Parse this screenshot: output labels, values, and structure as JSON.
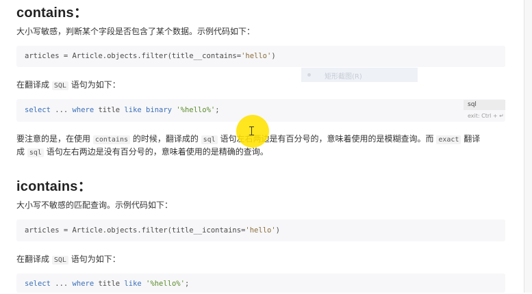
{
  "sections": {
    "contains": {
      "heading": "contains：",
      "intro": "大小写敏感，判断某个字段是否包含了某个数据。示例代码如下：",
      "code_python": {
        "lead": "articles = Article.objects.filter(title__contains=",
        "string": "'hello'",
        "tail": ")"
      },
      "sql_intro_prefix": "在翻译成 ",
      "sql_intro_code": "SQL",
      "sql_intro_suffix": " 语句为如下：",
      "code_sql": {
        "select": "select",
        "mid1": " ... ",
        "where": "where",
        "mid2": " title ",
        "like": "like",
        "mid3": " ",
        "binary": "binary",
        "mid4": " ",
        "string": "'%hello%'",
        "tail": ";"
      },
      "note_line1": {
        "p1": "要注意的是，在使用 ",
        "c1": "contains",
        "p2": " 的时候，翻译成的 ",
        "c2": "sql",
        "p3": " 语句左右两边是有百分号的，意味着使用的是模糊查询。而 ",
        "c3": "exact",
        "p4": " 翻译"
      },
      "note_line2": {
        "p1": "成 ",
        "c1": "sql",
        "p2": " 语句左右两边是没有百分号的，意味着使用的是精确的查询。"
      }
    },
    "icontains": {
      "heading": "icontains：",
      "intro": "大小写不敏感的匹配查询。示例代码如下：",
      "code_python": {
        "lead": "articles = Article.objects.filter(title__icontains=",
        "string": "'hello'",
        "tail": ")"
      },
      "sql_intro_prefix": "在翻译成 ",
      "sql_intro_code": "SQL",
      "sql_intro_suffix": " 语句为如下：",
      "code_sql": {
        "select": "select",
        "mid1": " ... ",
        "where": "where",
        "mid2": " title ",
        "like": "like",
        "mid3": " ",
        "string": "'%hello%'",
        "tail": ";"
      }
    }
  },
  "overlay": {
    "lang_tag": "sql",
    "exit_hint": "exit: Ctrl + ↵",
    "context_menu_item": "矩形截图(R)"
  },
  "colors": {
    "keyword": "#3b6fb6",
    "string": "#5a8c2b",
    "cursor_highlight": "#ffe200"
  }
}
